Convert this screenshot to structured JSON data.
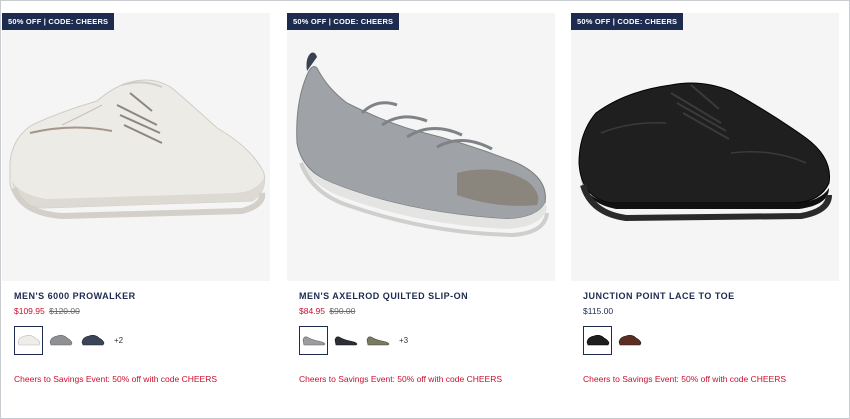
{
  "products": [
    {
      "badge": "50% OFF | CODE: CHEERS",
      "name": "MEN'S 6000 PROWALKER",
      "sale_price": "$109.95",
      "original_price": "$120.00",
      "swatches": [
        "white",
        "grey",
        "navy"
      ],
      "more_colors": "+2",
      "promo": "Cheers to Savings Event: 50% off with code CHEERS"
    },
    {
      "badge": "50% OFF | CODE: CHEERS",
      "name": "MEN'S AXELROD QUILTED SLIP-ON",
      "sale_price": "$84.95",
      "original_price": "$90.00",
      "swatches": [
        "grey",
        "black",
        "olive"
      ],
      "more_colors": "+3",
      "promo": "Cheers to Savings Event: 50% off with code CHEERS"
    },
    {
      "badge": "50% OFF | CODE: CHEERS",
      "name": "JUNCTION POINT LACE TO TOE",
      "price": "$115.00",
      "swatches": [
        "black",
        "brown"
      ],
      "promo": "Cheers to Savings Event: 50% off with code CHEERS"
    }
  ],
  "colors": {
    "badge_bg": "#1d2b4f",
    "sale_red": "#c8102e",
    "navy_text": "#1d2b4f"
  }
}
